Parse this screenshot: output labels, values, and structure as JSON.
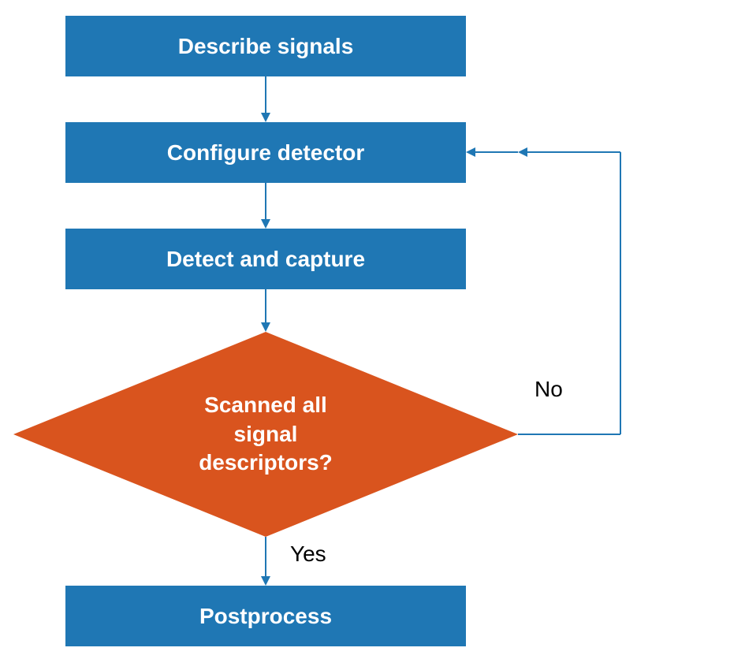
{
  "flowchart": {
    "nodes": {
      "describe_signals": "Describe signals",
      "configure_detector": "Configure detector",
      "detect_capture": "Detect and capture",
      "decision": "Scanned all\nsignal\ndescriptors?",
      "postprocess": "Postprocess"
    },
    "edges": {
      "yes_label": "Yes",
      "no_label": "No"
    },
    "colors": {
      "box_fill": "#1f77b4",
      "diamond_fill": "#d9541e",
      "arrow": "#1f77b4"
    }
  }
}
